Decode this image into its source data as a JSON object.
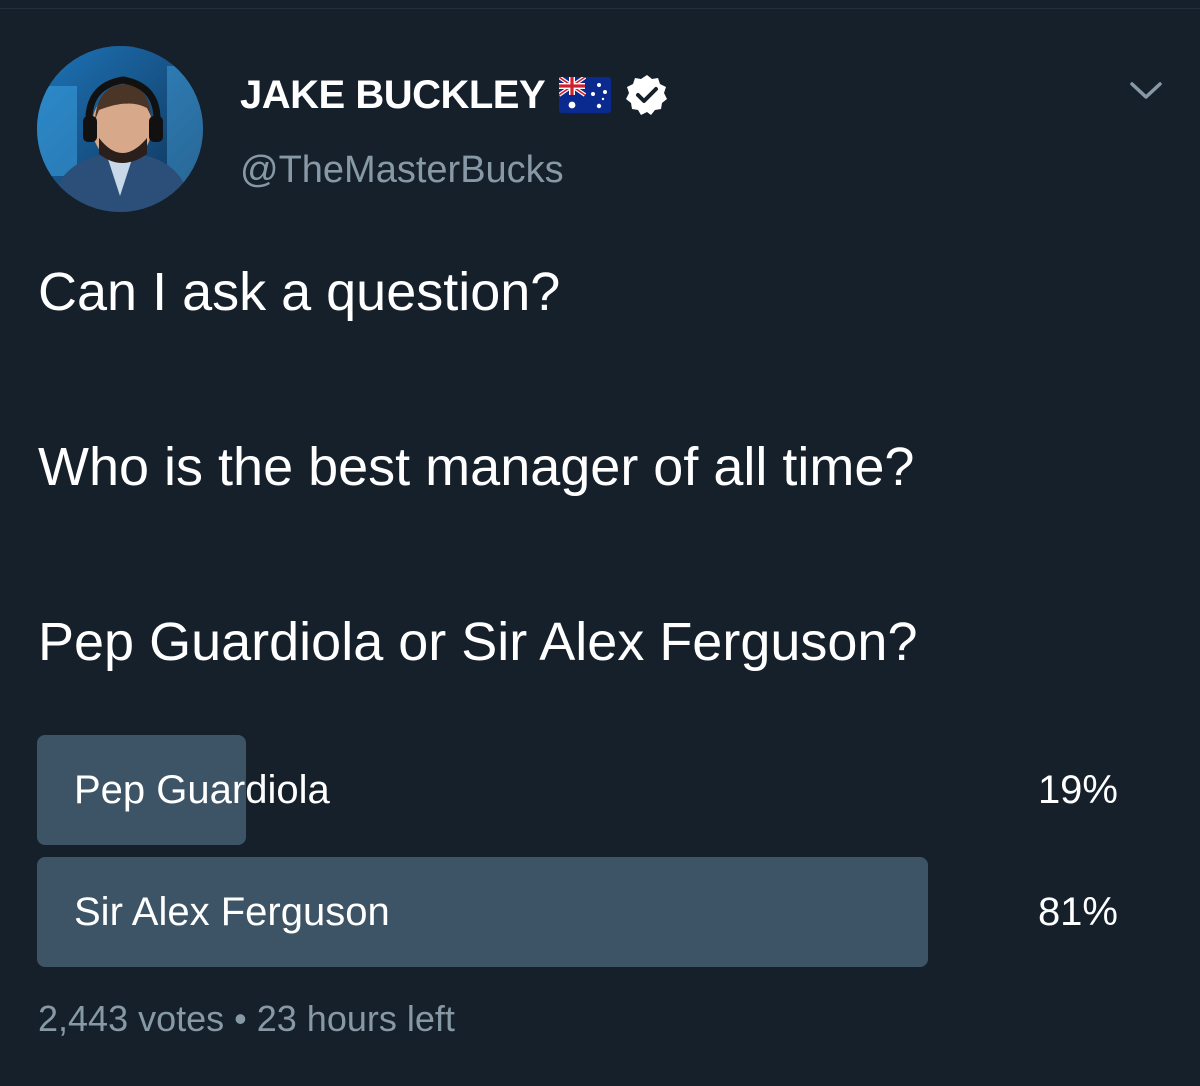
{
  "author": {
    "display_name": "JAKE BUCKLEY",
    "flag": "australia-flag-icon",
    "verified": true,
    "handle": "@TheMasterBucks"
  },
  "tweet": {
    "lines": [
      "Can I ask a question?",
      "Who is the best manager of all time?",
      "Pep Guardiola or Sir Alex Ferguson?"
    ]
  },
  "poll": {
    "options": [
      {
        "label": "Pep Guardiola",
        "percent_text": "19%",
        "percent": 19
      },
      {
        "label": "Sir Alex Ferguson",
        "percent_text": "81%",
        "percent": 81
      }
    ],
    "votes": "2,443 votes",
    "separator": "•",
    "time_left": "23 hours left"
  },
  "colors": {
    "background": "#15202b",
    "poll_bar": "#3d5466",
    "secondary_text": "#8899a6",
    "verified_badge": "#ffffff"
  }
}
